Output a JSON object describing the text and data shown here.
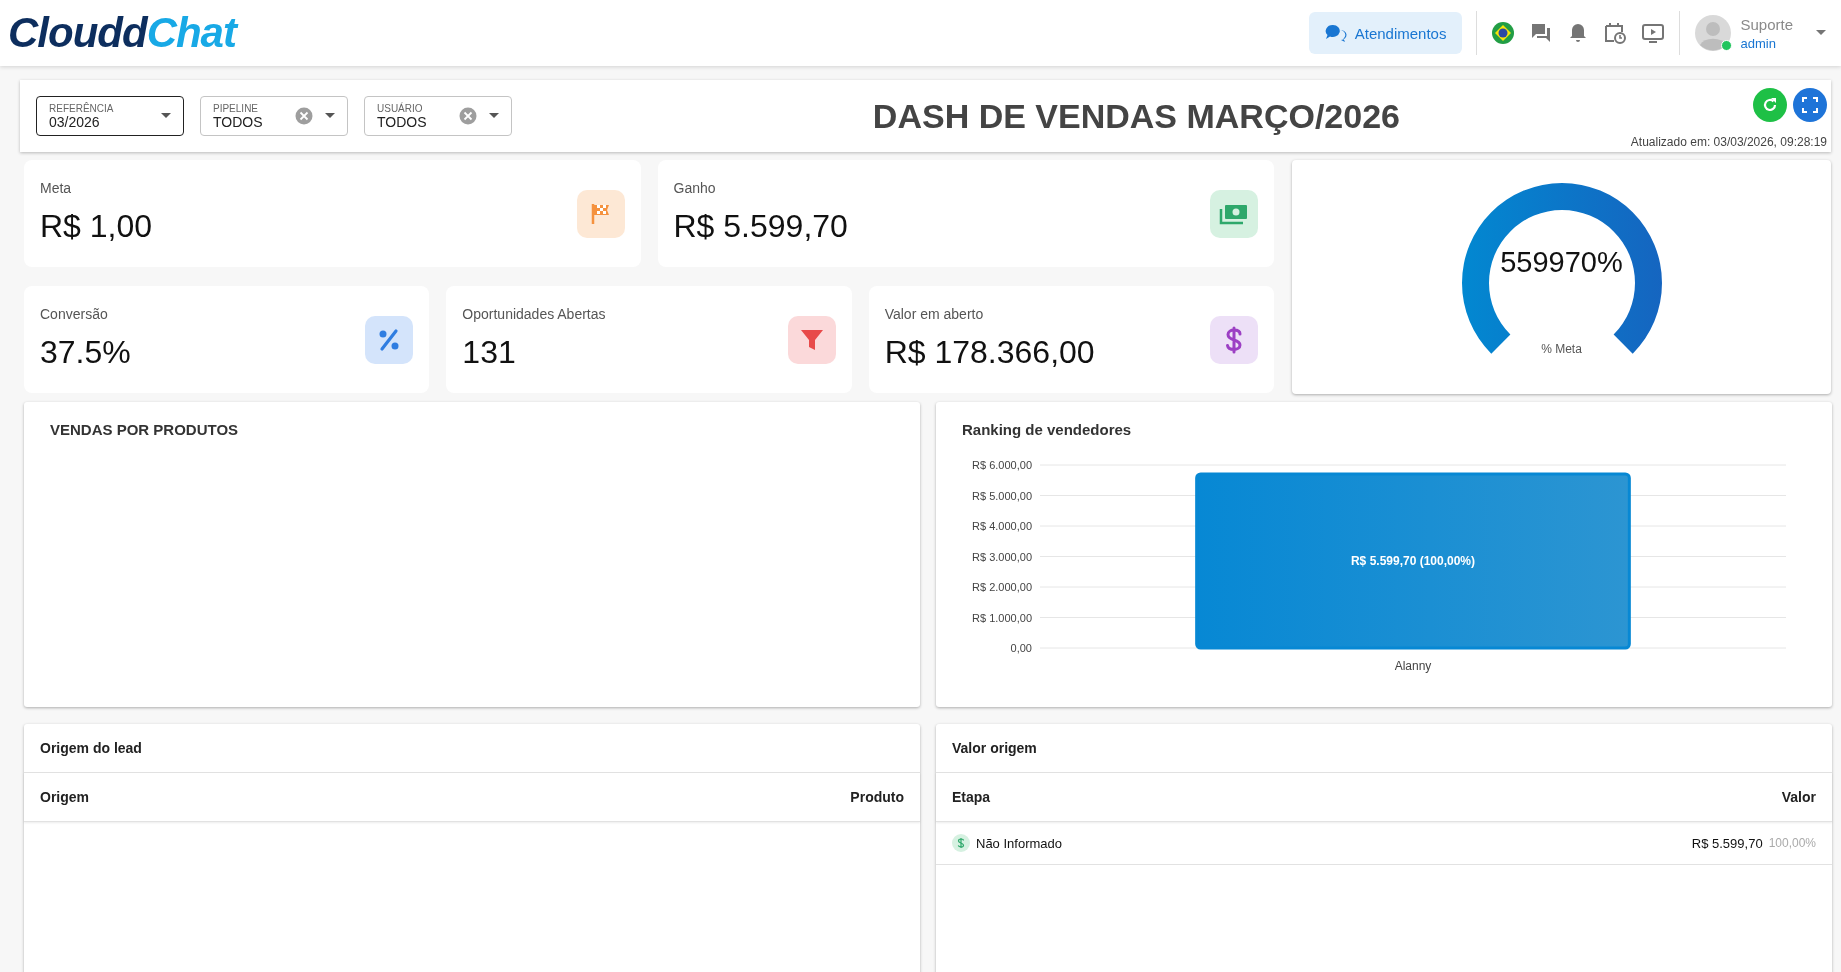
{
  "header": {
    "logo": {
      "part_1": "Cloudd",
      "part_2": "Chat"
    },
    "attendance_button": "Atendimentos",
    "user": {
      "name": "Suporte",
      "role": "admin",
      "online": true
    }
  },
  "filters": [
    {
      "label": "REFERÊNCIA",
      "value": "03/2026",
      "clearable": false
    },
    {
      "label": "PIPELINE",
      "value": "TODOS",
      "clearable": true
    },
    {
      "label": "USUÁRIO",
      "value": "TODOS",
      "clearable": true
    }
  ],
  "dashboard": {
    "title": "DASH DE VENDAS MARÇO/2026",
    "updated": "Atualizado em: 03/03/2026, 09:28:19"
  },
  "kpis": [
    {
      "label": "Meta",
      "value": "R$ 1,00",
      "kind": "flag",
      "color": "#f5923e"
    },
    {
      "label": "Ganho",
      "value": "R$ 5.599,70",
      "kind": "money",
      "color": "#2ea86b"
    },
    {
      "label": "Conversão",
      "value": "37.5%",
      "kind": "percent",
      "color": "#2f7de1"
    },
    {
      "label": "Oportunidades Abertas",
      "value": "131",
      "kind": "funnel",
      "color": "#e84a4a"
    },
    {
      "label": "Valor em aberto",
      "value": "R$ 178.366,00",
      "kind": "dollar",
      "color": "#9c3fc4"
    }
  ],
  "gauge": {
    "reading": "559970%",
    "caption": "% Meta"
  },
  "products_panel": {
    "title": "VENDAS POR PRODUTOS"
  },
  "ranking": {
    "title": "Ranking de vendedores",
    "y_axis_labels": [
      "R$ 6.000,00",
      "R$ 5.000,00",
      "R$ 4.000,00",
      "R$ 3.000,00",
      "R$ 2.000,00",
      "R$ 1.000,00",
      "0,00"
    ],
    "bars": [
      {
        "category": "Alanny",
        "value_label": "R$ 5.599,70 (100,00%)"
      }
    ]
  },
  "lead_origin": {
    "title": "Origem do lead",
    "columns": [
      "Origem",
      "Produto"
    ]
  },
  "origin_value": {
    "title": "Valor origem",
    "columns": [
      "Etapa",
      "Valor"
    ],
    "rows": [
      {
        "stage": "Não Informado",
        "value": "R$ 5.599,70",
        "share": "100,00%"
      }
    ]
  }
}
